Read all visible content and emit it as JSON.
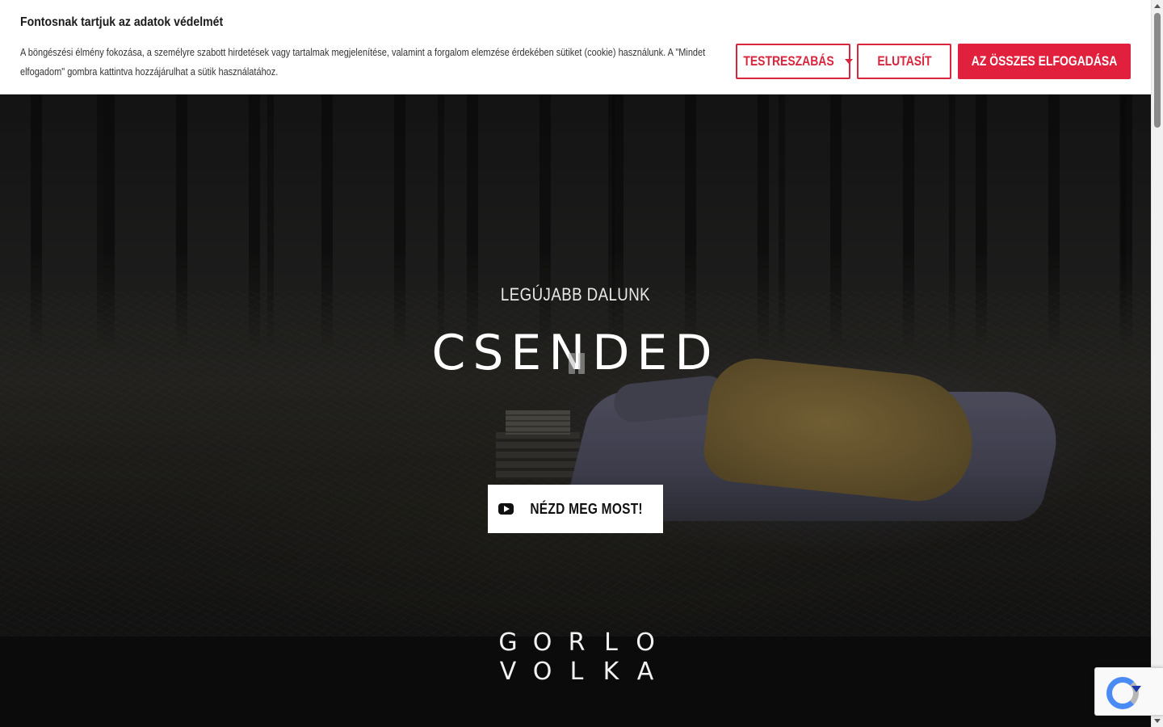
{
  "cookie_banner": {
    "title": "Fontosnak tartjuk az adatok védelmét",
    "text": "A böngészési élmény fokozása, a személyre szabott hirdetések vagy tartalmak megjelenítése, valamint a forgalom elemzése érdekében sütiket (cookie) használunk. A \"Mindet elfogadom\" gombra kattintva hozzájárulhat a sütik használatához.",
    "customize_label": "TESTRESZABÁS",
    "reject_label": "ELUTASÍT",
    "accept_all_label": "AZ ÖSSZES ELFOGADÁSA",
    "accent_color": "#e0203d"
  },
  "hero": {
    "kicker": "LEGÚJABB DALUNK",
    "title": "CSENDED",
    "watch_label": "NÉZD MEG MOST!",
    "watch_icon": "youtube-play-icon",
    "video_state_icon": "pause-icon"
  },
  "logo": {
    "line1": [
      "G",
      "O",
      "R",
      "L",
      "O"
    ],
    "line2": [
      "V",
      "O",
      "L",
      "K",
      "A"
    ]
  },
  "widgets": {
    "recaptcha_icon": "recaptcha-icon"
  }
}
